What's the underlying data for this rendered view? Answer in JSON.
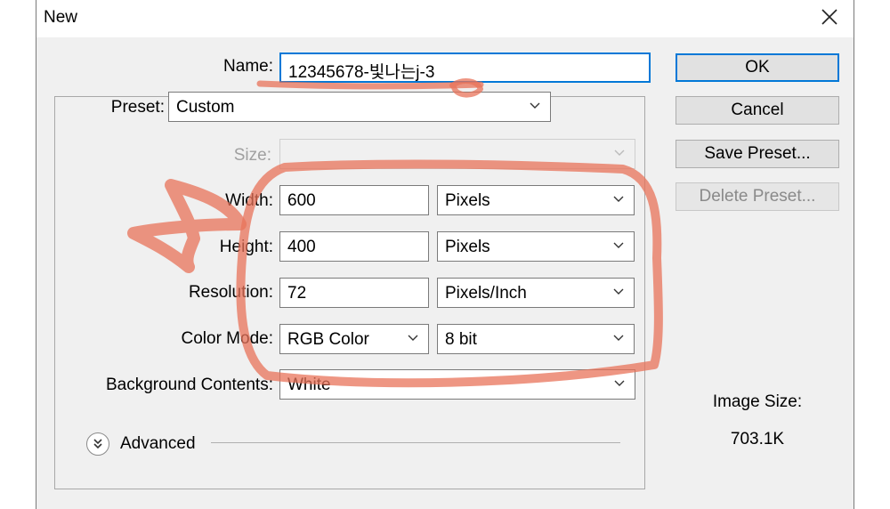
{
  "window": {
    "title": "New"
  },
  "form": {
    "name_label": "Name:",
    "name_value": "12345678-빛나는j-3",
    "preset_label": "Preset:",
    "preset_value": "Custom",
    "size_label": "Size:",
    "size_value": "",
    "width_label": "Width:",
    "width_value": "600",
    "width_unit": "Pixels",
    "height_label": "Height:",
    "height_value": "400",
    "height_unit": "Pixels",
    "resolution_label": "Resolution:",
    "resolution_value": "72",
    "resolution_unit": "Pixels/Inch",
    "color_mode_label": "Color Mode:",
    "color_mode_value": "RGB Color",
    "bit_depth_value": "8 bit",
    "background_label": "Background Contents:",
    "background_value": "White",
    "advanced_label": "Advanced"
  },
  "buttons": {
    "ok": "OK",
    "cancel": "Cancel",
    "save_preset": "Save Preset...",
    "delete_preset": "Delete Preset..."
  },
  "image_size": {
    "label": "Image Size:",
    "value": "703.1K"
  },
  "colors": {
    "focus_accent": "#0078d7",
    "annotation": "#e8735a"
  },
  "icons": [
    "close-icon",
    "chevron-down-icon",
    "double-chevron-down-icon"
  ]
}
